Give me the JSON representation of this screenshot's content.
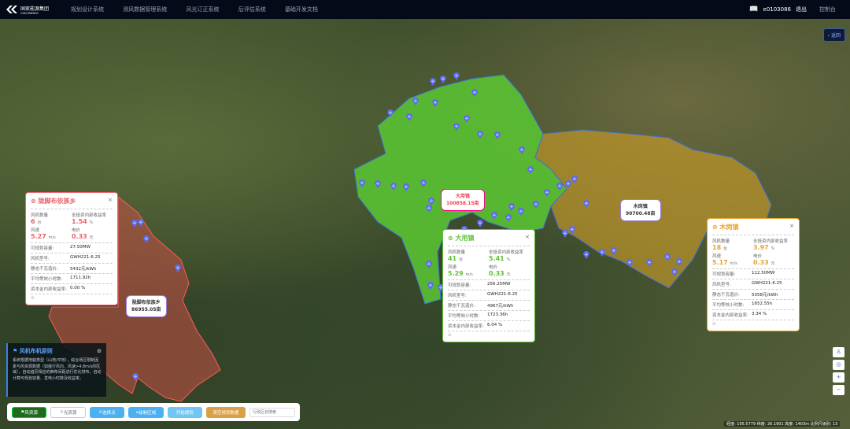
{
  "header": {
    "logo_name": "国家能源集团",
    "logo_sub": "CHN ENERGY",
    "nav": [
      "规划设计系统",
      "测风数据管理系统",
      "风光订正系统",
      "后评估系统",
      "基础开发文档"
    ],
    "user": "e0103086",
    "logout": "退出",
    "console": "控制台",
    "back": "返回"
  },
  "regions": [
    {
      "name": "陇脚布依族乡",
      "area": "86955.05亩",
      "color": "#e8646e"
    },
    {
      "name": "大用镇",
      "area": "100858.15亩",
      "color": "#5fc237"
    },
    {
      "name": "木岗镇",
      "area": "90700.48亩",
      "color": "#e7a332"
    }
  ],
  "card_labels": {
    "count": "风机数量",
    "irr": "全投资内部收益率",
    "speed": "风速",
    "price": "电价",
    "capacity": "可规划容量:",
    "model": "风机型号:",
    "cost": "静态千瓦造价:",
    "hours": "平均等效小时数:",
    "cap_irr": "资本金内部收益率:"
  },
  "cards": [
    {
      "name": "陇脚布依族乡",
      "count": "6",
      "count_unit": "台",
      "irr": "1.54",
      "irr_unit": "%",
      "speed": "5.27",
      "speed_unit": "m/s",
      "price": "0.33",
      "price_unit": "元",
      "capacity": "27.50MW",
      "model": "GWH221-6.25",
      "cost": "5432元/kWh",
      "hours": "1711.92h",
      "cap_irr": "0.00 %"
    },
    {
      "name": "大用镇",
      "count": "41",
      "count_unit": "台",
      "irr": "5.41",
      "irr_unit": "%",
      "speed": "5.29",
      "speed_unit": "m/s",
      "price": "0.33",
      "price_unit": "元",
      "capacity": "256.25MW",
      "model": "GWH221-6.25",
      "cost": "4967元/kWh",
      "hours": "1723.36h",
      "cap_irr": "6.04 %"
    },
    {
      "name": "木岗镇",
      "count": "18",
      "count_unit": "台",
      "irr": "3.97",
      "irr_unit": "%",
      "speed": "5.17",
      "speed_unit": "m/s",
      "price": "0.33",
      "price_unit": "元",
      "capacity": "112.50MW",
      "model": "GWH221-6.25",
      "cost": "5058元/kWh",
      "hours": "1652.55h",
      "cap_irr": "3.34 %"
    }
  ],
  "tip": {
    "title": "风机布机原则",
    "body": "系统根据地貌类型（山地/平地），综合场区限制因素与风资源数据（如盛行风向、风速>4.8m/s的区域），自动遍历相应的推荐间距进行优化排布，自动计算可规划容量、发电小时数及收益率。"
  },
  "toolbar": {
    "wind": "风资源",
    "solar": "光资源",
    "select": "选择点",
    "draw": "绘制区域",
    "plan": "开始规划",
    "clear": "清空规划数据",
    "search_placeholder": "行政区划搜索"
  },
  "status": "经度: 105.5779 纬度: 26.1901 高度: 1403m 比例尺级别: 13"
}
